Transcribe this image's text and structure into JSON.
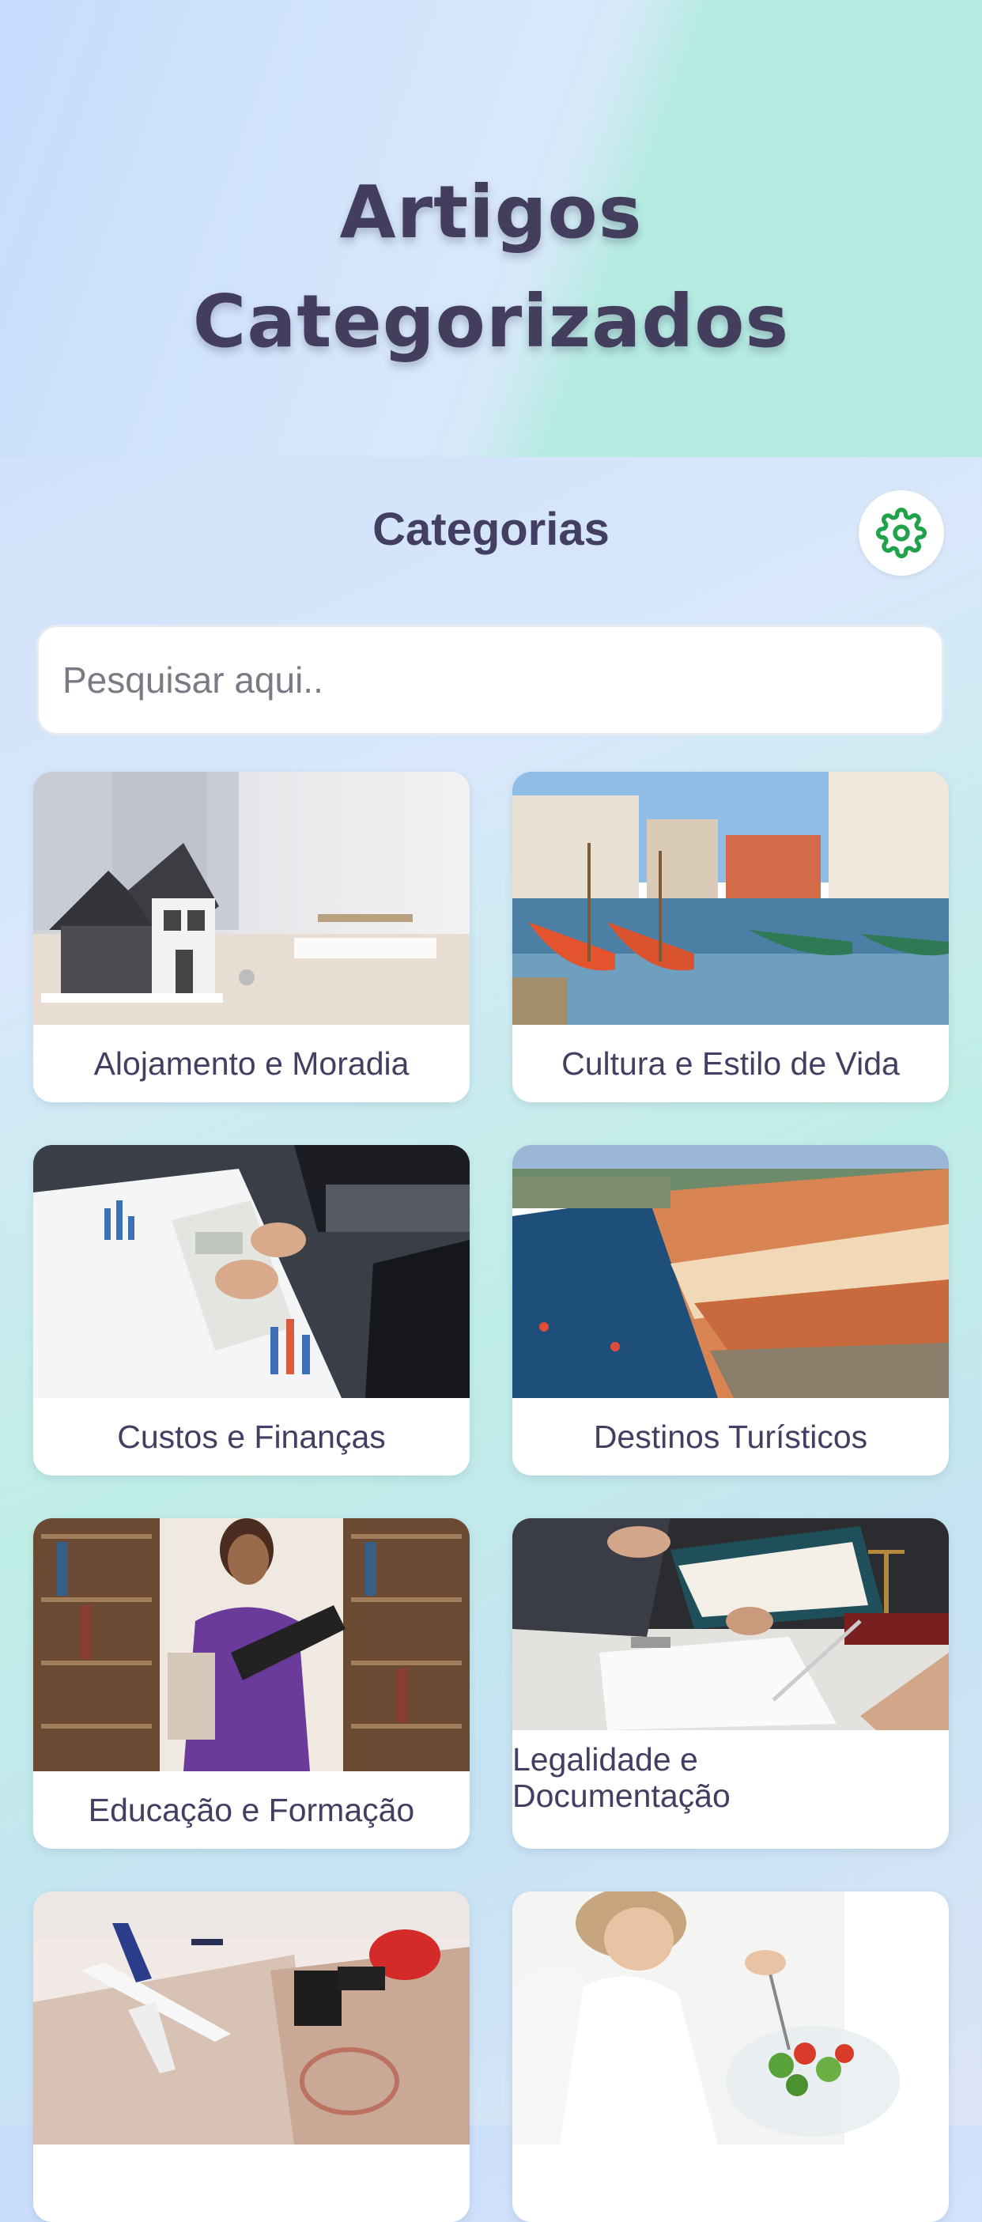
{
  "header": {
    "title_line1": "Artigos",
    "title_line2": "Categorizados"
  },
  "section": {
    "title": "Categorias",
    "settings_icon": "gear-icon",
    "settings_color": "#1fa24a"
  },
  "search": {
    "placeholder": "Pesquisar aqui..",
    "value": ""
  },
  "categories": [
    {
      "label": "Alojamento e Moradia",
      "image": "house-model-photo"
    },
    {
      "label": "Cultura e Estilo de Vida",
      "image": "boats-canal-photo"
    },
    {
      "label": "Custos e Finanças",
      "image": "calculator-finance-photo"
    },
    {
      "label": "Destinos Turísticos",
      "image": "river-city-photo"
    },
    {
      "label": "Educação e Formação",
      "image": "library-student-photo"
    },
    {
      "label": "Legalidade e Documentação",
      "image": "legal-documents-photo"
    },
    {
      "label": "",
      "image": "airplane-passport-photo"
    },
    {
      "label": "",
      "image": "salad-meal-photo"
    }
  ]
}
